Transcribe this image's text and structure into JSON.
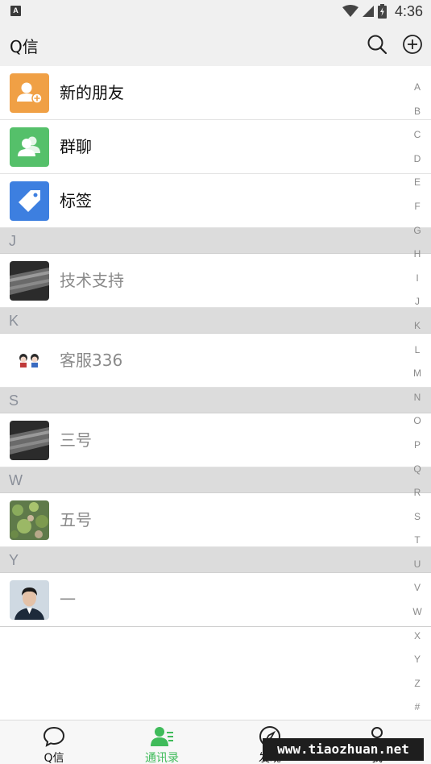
{
  "status_bar": {
    "left_icon_letter": "A",
    "time": "4:36"
  },
  "app_bar": {
    "title": "Q信",
    "search_icon": "search-icon",
    "add_icon": "plus-circle-icon"
  },
  "fixed_items": [
    {
      "label": "新的朋友",
      "icon": "new-friend-icon",
      "color": "#f0a045"
    },
    {
      "label": "群聊",
      "icon": "group-chat-icon",
      "color": "#55c06a"
    },
    {
      "label": "标签",
      "icon": "tag-icon",
      "color": "#3d7fe0"
    }
  ],
  "sections": [
    {
      "letter": "J",
      "contact": "技术支持"
    },
    {
      "letter": "K",
      "contact": "客服336"
    },
    {
      "letter": "S",
      "contact": "三号"
    },
    {
      "letter": "W",
      "contact": "五号"
    },
    {
      "letter": "Y",
      "contact": "一"
    }
  ],
  "alpha_index": [
    "A",
    "B",
    "C",
    "D",
    "E",
    "F",
    "G",
    "H",
    "I",
    "J",
    "K",
    "L",
    "M",
    "N",
    "O",
    "P",
    "Q",
    "R",
    "S",
    "T",
    "U",
    "V",
    "W",
    "X",
    "Y",
    "Z",
    "#"
  ],
  "bottom_nav": {
    "tabs": [
      {
        "label": "Q信",
        "icon": "chat-bubble-icon"
      },
      {
        "label": "通讯录",
        "icon": "contacts-icon"
      },
      {
        "label": "发现",
        "icon": "compass-icon"
      },
      {
        "label": "我",
        "icon": "person-icon"
      }
    ],
    "active_tab": "通讯录",
    "active_color": "#3fbb5a"
  },
  "watermark": "www.tiaozhuan.net"
}
